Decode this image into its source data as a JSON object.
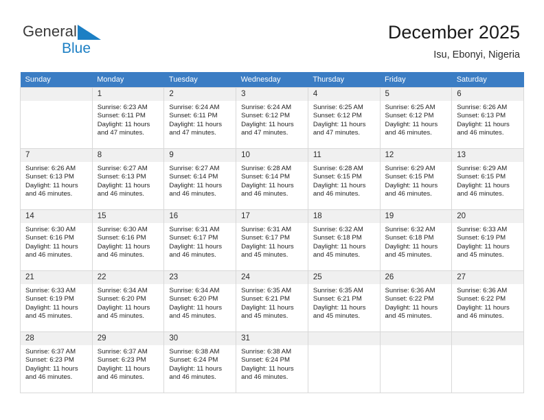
{
  "logo": {
    "word1": "General",
    "word2": "Blue",
    "triangle_color": "#1c7fc4",
    "word1_color": "#3a3a3a",
    "word2_color": "#1c7fc4"
  },
  "header": {
    "title": "December 2025",
    "subtitle": "Isu, Ebonyi, Nigeria"
  },
  "theme": {
    "header_bg": "#3b7dc4",
    "header_text": "#ffffff",
    "daynum_bg": "#f0f0f0",
    "grid_border": "#d8d8d8"
  },
  "calendar": {
    "weekdays": [
      "Sunday",
      "Monday",
      "Tuesday",
      "Wednesday",
      "Thursday",
      "Friday",
      "Saturday"
    ],
    "weeks": [
      [
        {
          "day": "",
          "sunrise": "",
          "sunset": "",
          "daylight": "",
          "empty": true
        },
        {
          "day": "1",
          "sunrise": "Sunrise: 6:23 AM",
          "sunset": "Sunset: 6:11 PM",
          "daylight": "Daylight: 11 hours and 47 minutes."
        },
        {
          "day": "2",
          "sunrise": "Sunrise: 6:24 AM",
          "sunset": "Sunset: 6:11 PM",
          "daylight": "Daylight: 11 hours and 47 minutes."
        },
        {
          "day": "3",
          "sunrise": "Sunrise: 6:24 AM",
          "sunset": "Sunset: 6:12 PM",
          "daylight": "Daylight: 11 hours and 47 minutes."
        },
        {
          "day": "4",
          "sunrise": "Sunrise: 6:25 AM",
          "sunset": "Sunset: 6:12 PM",
          "daylight": "Daylight: 11 hours and 47 minutes."
        },
        {
          "day": "5",
          "sunrise": "Sunrise: 6:25 AM",
          "sunset": "Sunset: 6:12 PM",
          "daylight": "Daylight: 11 hours and 46 minutes."
        },
        {
          "day": "6",
          "sunrise": "Sunrise: 6:26 AM",
          "sunset": "Sunset: 6:13 PM",
          "daylight": "Daylight: 11 hours and 46 minutes."
        }
      ],
      [
        {
          "day": "7",
          "sunrise": "Sunrise: 6:26 AM",
          "sunset": "Sunset: 6:13 PM",
          "daylight": "Daylight: 11 hours and 46 minutes."
        },
        {
          "day": "8",
          "sunrise": "Sunrise: 6:27 AM",
          "sunset": "Sunset: 6:13 PM",
          "daylight": "Daylight: 11 hours and 46 minutes."
        },
        {
          "day": "9",
          "sunrise": "Sunrise: 6:27 AM",
          "sunset": "Sunset: 6:14 PM",
          "daylight": "Daylight: 11 hours and 46 minutes."
        },
        {
          "day": "10",
          "sunrise": "Sunrise: 6:28 AM",
          "sunset": "Sunset: 6:14 PM",
          "daylight": "Daylight: 11 hours and 46 minutes."
        },
        {
          "day": "11",
          "sunrise": "Sunrise: 6:28 AM",
          "sunset": "Sunset: 6:15 PM",
          "daylight": "Daylight: 11 hours and 46 minutes."
        },
        {
          "day": "12",
          "sunrise": "Sunrise: 6:29 AM",
          "sunset": "Sunset: 6:15 PM",
          "daylight": "Daylight: 11 hours and 46 minutes."
        },
        {
          "day": "13",
          "sunrise": "Sunrise: 6:29 AM",
          "sunset": "Sunset: 6:15 PM",
          "daylight": "Daylight: 11 hours and 46 minutes."
        }
      ],
      [
        {
          "day": "14",
          "sunrise": "Sunrise: 6:30 AM",
          "sunset": "Sunset: 6:16 PM",
          "daylight": "Daylight: 11 hours and 46 minutes."
        },
        {
          "day": "15",
          "sunrise": "Sunrise: 6:30 AM",
          "sunset": "Sunset: 6:16 PM",
          "daylight": "Daylight: 11 hours and 46 minutes."
        },
        {
          "day": "16",
          "sunrise": "Sunrise: 6:31 AM",
          "sunset": "Sunset: 6:17 PM",
          "daylight": "Daylight: 11 hours and 46 minutes."
        },
        {
          "day": "17",
          "sunrise": "Sunrise: 6:31 AM",
          "sunset": "Sunset: 6:17 PM",
          "daylight": "Daylight: 11 hours and 45 minutes."
        },
        {
          "day": "18",
          "sunrise": "Sunrise: 6:32 AM",
          "sunset": "Sunset: 6:18 PM",
          "daylight": "Daylight: 11 hours and 45 minutes."
        },
        {
          "day": "19",
          "sunrise": "Sunrise: 6:32 AM",
          "sunset": "Sunset: 6:18 PM",
          "daylight": "Daylight: 11 hours and 45 minutes."
        },
        {
          "day": "20",
          "sunrise": "Sunrise: 6:33 AM",
          "sunset": "Sunset: 6:19 PM",
          "daylight": "Daylight: 11 hours and 45 minutes."
        }
      ],
      [
        {
          "day": "21",
          "sunrise": "Sunrise: 6:33 AM",
          "sunset": "Sunset: 6:19 PM",
          "daylight": "Daylight: 11 hours and 45 minutes."
        },
        {
          "day": "22",
          "sunrise": "Sunrise: 6:34 AM",
          "sunset": "Sunset: 6:20 PM",
          "daylight": "Daylight: 11 hours and 45 minutes."
        },
        {
          "day": "23",
          "sunrise": "Sunrise: 6:34 AM",
          "sunset": "Sunset: 6:20 PM",
          "daylight": "Daylight: 11 hours and 45 minutes."
        },
        {
          "day": "24",
          "sunrise": "Sunrise: 6:35 AM",
          "sunset": "Sunset: 6:21 PM",
          "daylight": "Daylight: 11 hours and 45 minutes."
        },
        {
          "day": "25",
          "sunrise": "Sunrise: 6:35 AM",
          "sunset": "Sunset: 6:21 PM",
          "daylight": "Daylight: 11 hours and 45 minutes."
        },
        {
          "day": "26",
          "sunrise": "Sunrise: 6:36 AM",
          "sunset": "Sunset: 6:22 PM",
          "daylight": "Daylight: 11 hours and 45 minutes."
        },
        {
          "day": "27",
          "sunrise": "Sunrise: 6:36 AM",
          "sunset": "Sunset: 6:22 PM",
          "daylight": "Daylight: 11 hours and 46 minutes."
        }
      ],
      [
        {
          "day": "28",
          "sunrise": "Sunrise: 6:37 AM",
          "sunset": "Sunset: 6:23 PM",
          "daylight": "Daylight: 11 hours and 46 minutes."
        },
        {
          "day": "29",
          "sunrise": "Sunrise: 6:37 AM",
          "sunset": "Sunset: 6:23 PM",
          "daylight": "Daylight: 11 hours and 46 minutes."
        },
        {
          "day": "30",
          "sunrise": "Sunrise: 6:38 AM",
          "sunset": "Sunset: 6:24 PM",
          "daylight": "Daylight: 11 hours and 46 minutes."
        },
        {
          "day": "31",
          "sunrise": "Sunrise: 6:38 AM",
          "sunset": "Sunset: 6:24 PM",
          "daylight": "Daylight: 11 hours and 46 minutes."
        },
        {
          "day": "",
          "sunrise": "",
          "sunset": "",
          "daylight": "",
          "empty": true
        },
        {
          "day": "",
          "sunrise": "",
          "sunset": "",
          "daylight": "",
          "empty": true
        },
        {
          "day": "",
          "sunrise": "",
          "sunset": "",
          "daylight": "",
          "empty": true
        }
      ]
    ]
  }
}
